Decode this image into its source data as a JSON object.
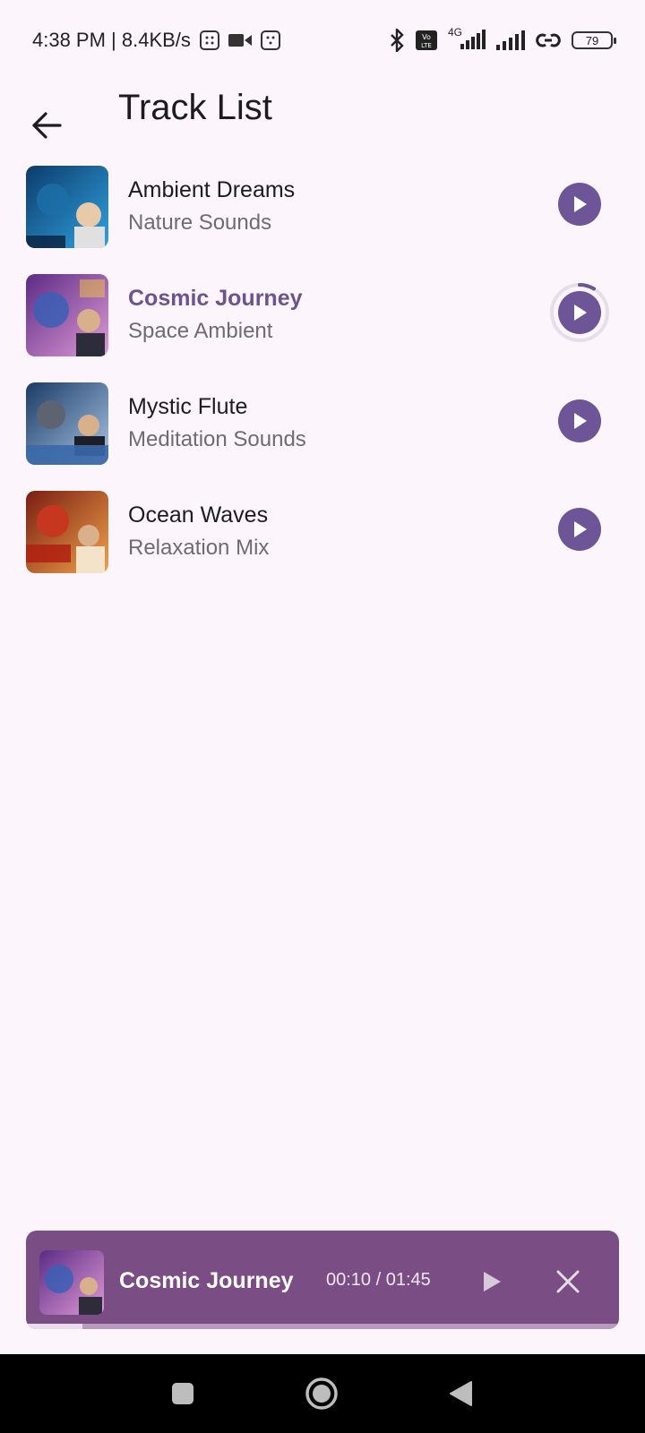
{
  "status_bar": {
    "time_speed": "4:38 PM | 8.4KB/s",
    "network_label": "4G",
    "battery_level": "79"
  },
  "app_bar": {
    "title": "Track List"
  },
  "tracks": [
    {
      "title": "Ambient Dreams",
      "subtitle": "Nature Sounds",
      "state": "idle",
      "art_colors": [
        "#0c3b6b",
        "#2fa2e0"
      ]
    },
    {
      "title": "Cosmic Journey",
      "subtitle": "Space Ambient",
      "state": "loading",
      "art_colors": [
        "#5b2b85",
        "#e09ad5"
      ]
    },
    {
      "title": "Mystic Flute",
      "subtitle": "Meditation Sounds",
      "state": "idle",
      "art_colors": [
        "#1b3a66",
        "#a9c6e6"
      ]
    },
    {
      "title": "Ocean Waves",
      "subtitle": "Relaxation Mix",
      "state": "idle",
      "art_colors": [
        "#7a1d12",
        "#f0a24a"
      ]
    }
  ],
  "mini_player": {
    "title": "Cosmic Journey",
    "time": "00:10 / 01:45",
    "progress": 0.095
  },
  "colors": {
    "accent": "#6d5597",
    "active_title": "#6c538f",
    "mini_player_bg": "#7a4e84",
    "background": "#fcf5fc"
  }
}
